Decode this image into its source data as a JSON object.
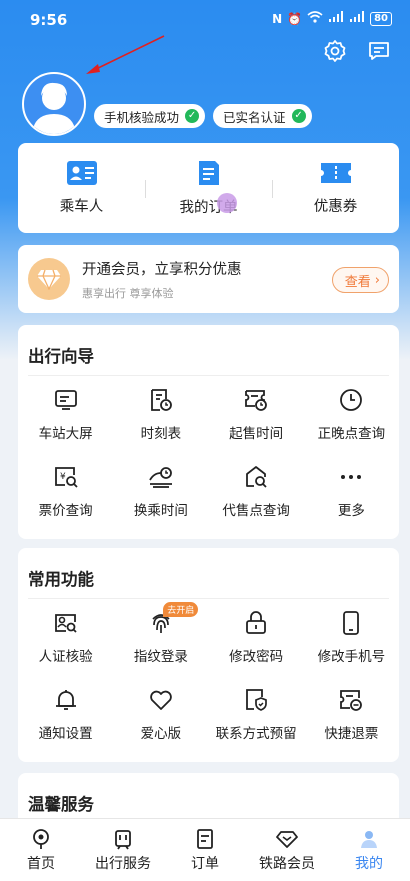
{
  "status_bar": {
    "time": "9:56",
    "battery": "80"
  },
  "header": {
    "settings_icon": "gear-icon",
    "message_icon": "message-icon"
  },
  "profile": {
    "badges": [
      {
        "label": "手机核验成功"
      },
      {
        "label": "已实名认证"
      }
    ]
  },
  "quick_actions": [
    {
      "label": "乘车人",
      "icon": "passenger-card-icon"
    },
    {
      "label": "我的订单",
      "icon": "order-doc-icon"
    },
    {
      "label": "优惠券",
      "icon": "coupon-icon"
    }
  ],
  "membership": {
    "title": "开通会员，立享积分优惠",
    "subtitle": "惠享出行 尊享体验",
    "button": "查看"
  },
  "travel_guide": {
    "title": "出行向导",
    "items": [
      {
        "label": "车站大屏",
        "icon": "station-screen-icon"
      },
      {
        "label": "时刻表",
        "icon": "timetable-icon"
      },
      {
        "label": "起售时间",
        "icon": "sale-time-icon"
      },
      {
        "label": "正晚点查询",
        "icon": "clock-icon"
      },
      {
        "label": "票价查询",
        "icon": "fare-query-icon"
      },
      {
        "label": "换乘时间",
        "icon": "transfer-time-icon"
      },
      {
        "label": "代售点查询",
        "icon": "agency-query-icon"
      },
      {
        "label": "更多",
        "icon": "more-icon"
      }
    ]
  },
  "common_functions": {
    "title": "常用功能",
    "new_tag": "去开启",
    "items": [
      {
        "label": "人证核验",
        "icon": "id-verify-icon"
      },
      {
        "label": "指纹登录",
        "icon": "fingerprint-icon"
      },
      {
        "label": "修改密码",
        "icon": "lock-icon"
      },
      {
        "label": "修改手机号",
        "icon": "phone-icon"
      },
      {
        "label": "通知设置",
        "icon": "bell-icon"
      },
      {
        "label": "爱心版",
        "icon": "heart-icon"
      },
      {
        "label": "联系方式预留",
        "icon": "contact-shield-icon"
      },
      {
        "label": "快捷退票",
        "icon": "refund-ticket-icon"
      }
    ]
  },
  "warm_service": {
    "title": "温馨服务"
  },
  "tab_bar": [
    {
      "label": "首页",
      "icon": "home-icon"
    },
    {
      "label": "出行服务",
      "icon": "travel-service-icon"
    },
    {
      "label": "订单",
      "icon": "order-icon"
    },
    {
      "label": "铁路会员",
      "icon": "member-gem-icon"
    },
    {
      "label": "我的",
      "icon": "profile-icon",
      "active": true
    }
  ],
  "colors": {
    "primary": "#2b8cf0",
    "accent_orange": "#f07a3a",
    "success": "#22b85a"
  }
}
